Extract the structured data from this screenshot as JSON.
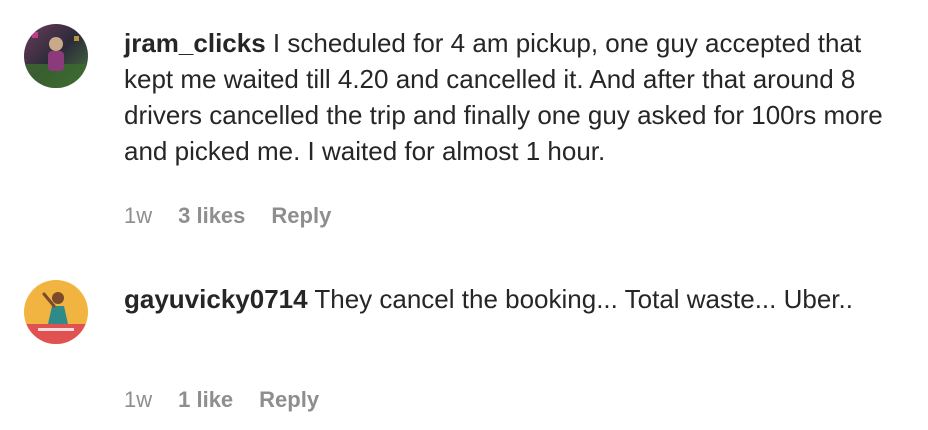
{
  "comments": [
    {
      "username": "jram_clicks",
      "text": "I scheduled for 4 am pickup, one guy accepted that kept me waited till 4.20 and cancelled it. And after that around 8 drivers cancelled the trip and finally one guy asked for 100rs more and picked me. I waited for almost 1 hour.",
      "time": "1w",
      "likes": "3 likes",
      "reply": "Reply"
    },
    {
      "username": "gayuvicky0714",
      "text": "They cancel the booking... Total waste... Uber..",
      "time": "1w",
      "likes": "1 like",
      "reply": "Reply"
    }
  ],
  "colors": {
    "text": "#262626",
    "secondary": "#8e8e8e",
    "avatar2_bg": "#f2b441",
    "avatar2_band": "#e05252"
  },
  "icons": {
    "avatar1": "user-photo-avatar",
    "avatar2": "user-photo-avatar"
  }
}
